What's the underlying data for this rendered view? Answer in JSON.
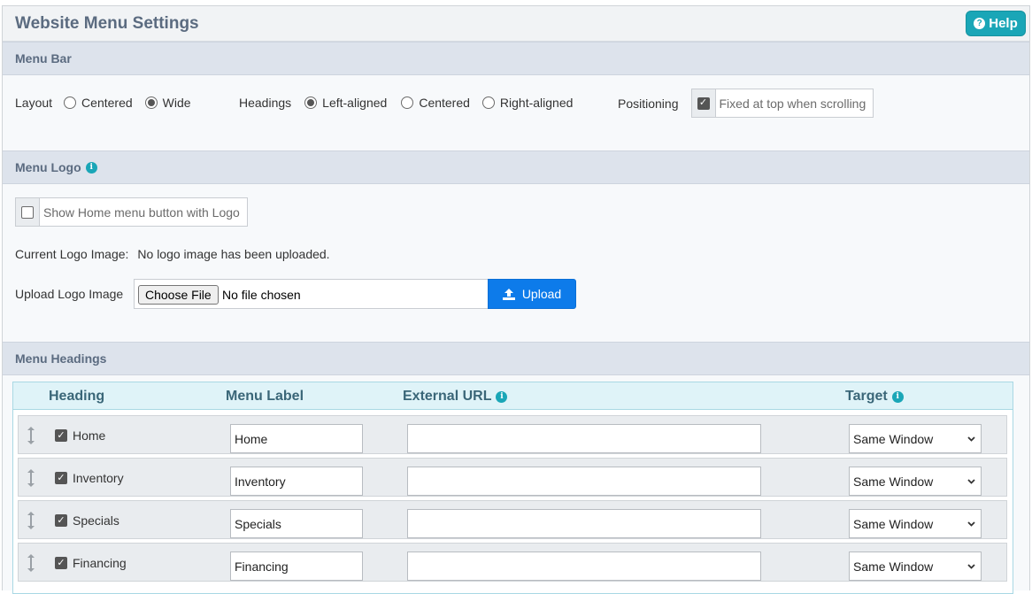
{
  "page": {
    "title": "Website Menu Settings",
    "help_label": "Help"
  },
  "menu_bar": {
    "title": "Menu Bar",
    "layout": {
      "label": "Layout",
      "options": [
        "Centered",
        "Wide"
      ],
      "selected": "Wide"
    },
    "headings": {
      "label": "Headings",
      "options": [
        "Left-aligned",
        "Centered",
        "Right-aligned"
      ],
      "selected": "Left-aligned"
    },
    "positioning": {
      "label": "Positioning",
      "option": "Fixed at top when scrolling",
      "checked": true
    }
  },
  "menu_logo": {
    "title": "Menu Logo",
    "show_home": {
      "label": "Show Home menu button with Logo",
      "checked": false
    },
    "current_label": "Current Logo Image:",
    "current_value": "No logo image has been uploaded.",
    "upload_label": "Upload Logo Image",
    "choose_file": "Choose File",
    "no_file": "No file chosen",
    "upload_button": "Upload"
  },
  "menu_headings": {
    "title": "Menu Headings",
    "columns": {
      "heading": "Heading",
      "menu_label": "Menu Label",
      "external_url": "External URL",
      "target": "Target"
    },
    "rows": [
      {
        "heading": "Home",
        "label": "Home",
        "url": "",
        "target": "Same Window",
        "checked": true
      },
      {
        "heading": "Inventory",
        "label": "Inventory",
        "url": "",
        "target": "Same Window",
        "checked": true
      },
      {
        "heading": "Specials",
        "label": "Specials",
        "url": "",
        "target": "Same Window",
        "checked": true
      },
      {
        "heading": "Financing",
        "label": "Financing",
        "url": "",
        "target": "Same Window",
        "checked": true
      }
    ]
  },
  "colors": {
    "accent": "#1aa6b7",
    "upload": "#0d7bea",
    "section": "#dde3ec",
    "table_head": "#dff3f8"
  }
}
